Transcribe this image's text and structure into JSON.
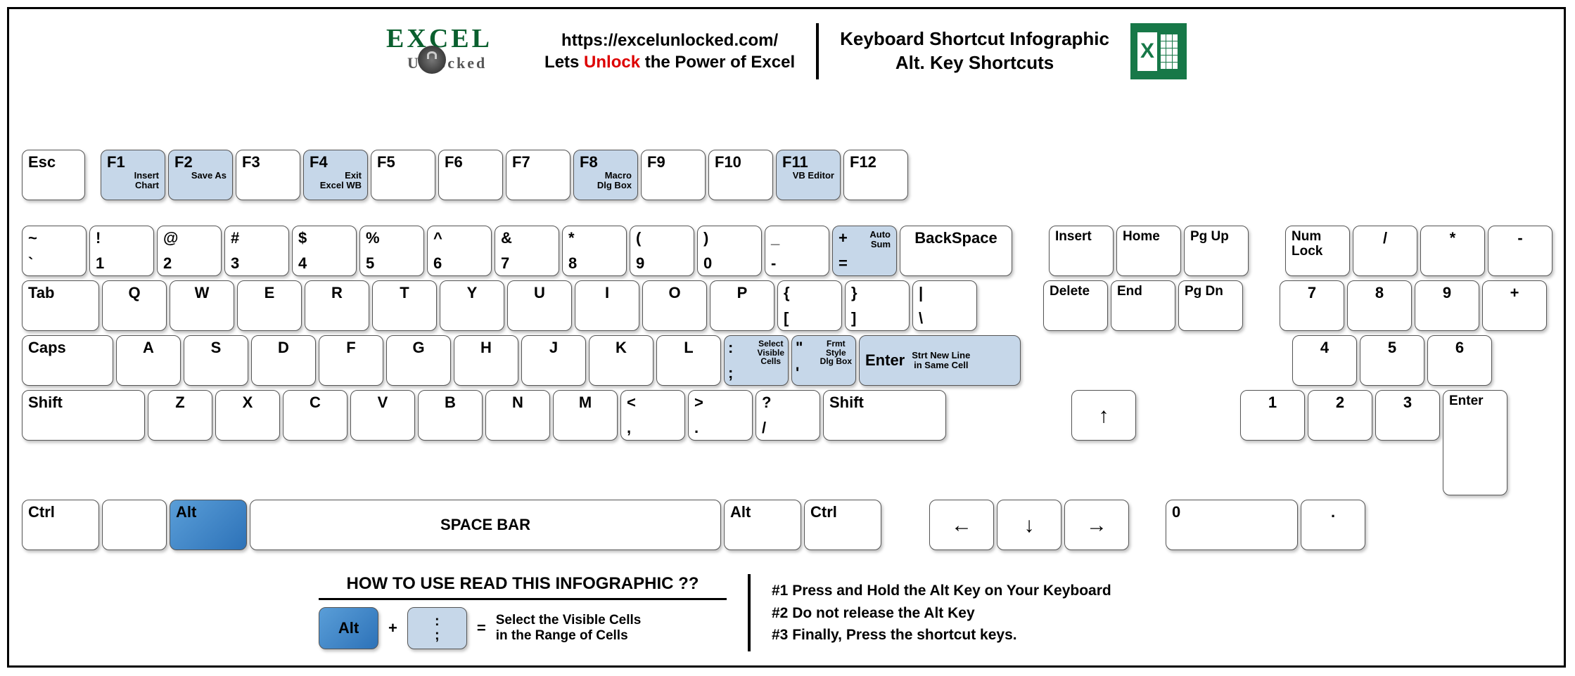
{
  "header": {
    "logo_top": "EXCEL",
    "logo_bottom": "Unlocked",
    "url": "https://excelunlocked.com/",
    "tagline_pre": "Lets ",
    "tagline_unlock": "Unlock",
    "tagline_post": " the Power of Excel",
    "title_line1": "Keyboard Shortcut Infographic",
    "title_line2": "Alt. Key Shortcuts",
    "excel_x": "X"
  },
  "row_fn": {
    "esc": "Esc",
    "f1": "F1",
    "f1_sub": "Insert\nChart",
    "f2": "F2",
    "f2_sub": "Save As",
    "f3": "F3",
    "f4": "F4",
    "f4_sub": "Exit\nExcel WB",
    "f5": "F5",
    "f6": "F6",
    "f7": "F7",
    "f8": "F8",
    "f8_sub": "Macro\nDlg Box",
    "f9": "F9",
    "f10": "F10",
    "f11": "F11",
    "f11_sub": "VB Editor",
    "f12": "F12"
  },
  "row_num": {
    "tilde_top": "~",
    "tilde_bot": "`",
    "k1_top": "!",
    "k1_bot": "1",
    "k2_top": "@",
    "k2_bot": "2",
    "k3_top": "#",
    "k3_bot": "3",
    "k4_top": "$",
    "k4_bot": "4",
    "k5_top": "%",
    "k5_bot": "5",
    "k6_top": "^",
    "k6_bot": "6",
    "k7_top": "&",
    "k7_bot": "7",
    "k8_top": "*",
    "k8_bot": "8",
    "k9_top": "(",
    "k9_bot": "9",
    "k0_top": ")",
    "k0_bot": "0",
    "dash_top": "_",
    "dash_bot": "-",
    "eq_top": "+",
    "eq_bot": "=",
    "eq_sub": "Auto\nSum",
    "bksp": "BackSpace"
  },
  "nav": {
    "insert": "Insert",
    "home": "Home",
    "pgup": "Pg Up",
    "delete": "Delete",
    "end": "End",
    "pgdn": "Pg Dn",
    "numlock": "Num\nLock",
    "slash": "/",
    "star": "*",
    "minus": "-",
    "n7": "7",
    "n8": "8",
    "n9": "9",
    "plus": "+",
    "n4": "4",
    "n5": "5",
    "n6": "6",
    "n1": "1",
    "n2": "2",
    "n3": "3",
    "enter": "Enter",
    "n0": "0",
    "dot": "."
  },
  "row_q": {
    "tab": "Tab",
    "q": "Q",
    "w": "W",
    "e": "E",
    "r": "R",
    "t": "T",
    "y": "Y",
    "u": "U",
    "i": "I",
    "o": "O",
    "p": "P",
    "br1_top": "{",
    "br1_bot": "[",
    "br2_top": "}",
    "br2_bot": "]",
    "pipe_top": "|",
    "pipe_bot": "\\"
  },
  "row_a": {
    "caps": "Caps",
    "a": "A",
    "s": "S",
    "d": "D",
    "f": "F",
    "g": "G",
    "h": "H",
    "j": "J",
    "k": "K",
    "l": "L",
    "semi_top": ":",
    "semi_bot": ";",
    "semi_sub": "Select\nVisible\nCells",
    "quote_top": "\"",
    "quote_bot": "'",
    "quote_sub": "Frmt\nStyle\nDlg Box",
    "enter": "Enter",
    "enter_sub": "Strt New Line\nin Same Cell"
  },
  "row_z": {
    "shift": "Shift",
    "z": "Z",
    "x": "X",
    "c": "C",
    "v": "V",
    "b": "B",
    "n": "N",
    "m": "M",
    "comma_top": "<",
    "comma_bot": ",",
    "period_top": ">",
    "period_bot": ".",
    "slash_top": "?",
    "slash_bot": "/",
    "shift_r": "Shift"
  },
  "row_ctrl": {
    "ctrl": "Ctrl",
    "alt": "Alt",
    "space": "SPACE BAR",
    "alt_r": "Alt",
    "ctrl_r": "Ctrl"
  },
  "arrows": {
    "up": "↑",
    "left": "←",
    "down": "↓",
    "right": "→"
  },
  "footer": {
    "howto_title": "HOW TO USE READ THIS INFOGRAPHIC ??",
    "alt": "Alt",
    "plus": "+",
    "semi_top": ":",
    "semi_bot": ";",
    "eq": "=",
    "example": "Select the Visible Cells in the Range of Cells",
    "step1": "#1 Press and Hold the Alt Key on Your Keyboard",
    "step2": "#2 Do not release the Alt Key",
    "step3": "#3 Finally, Press the shortcut keys."
  }
}
